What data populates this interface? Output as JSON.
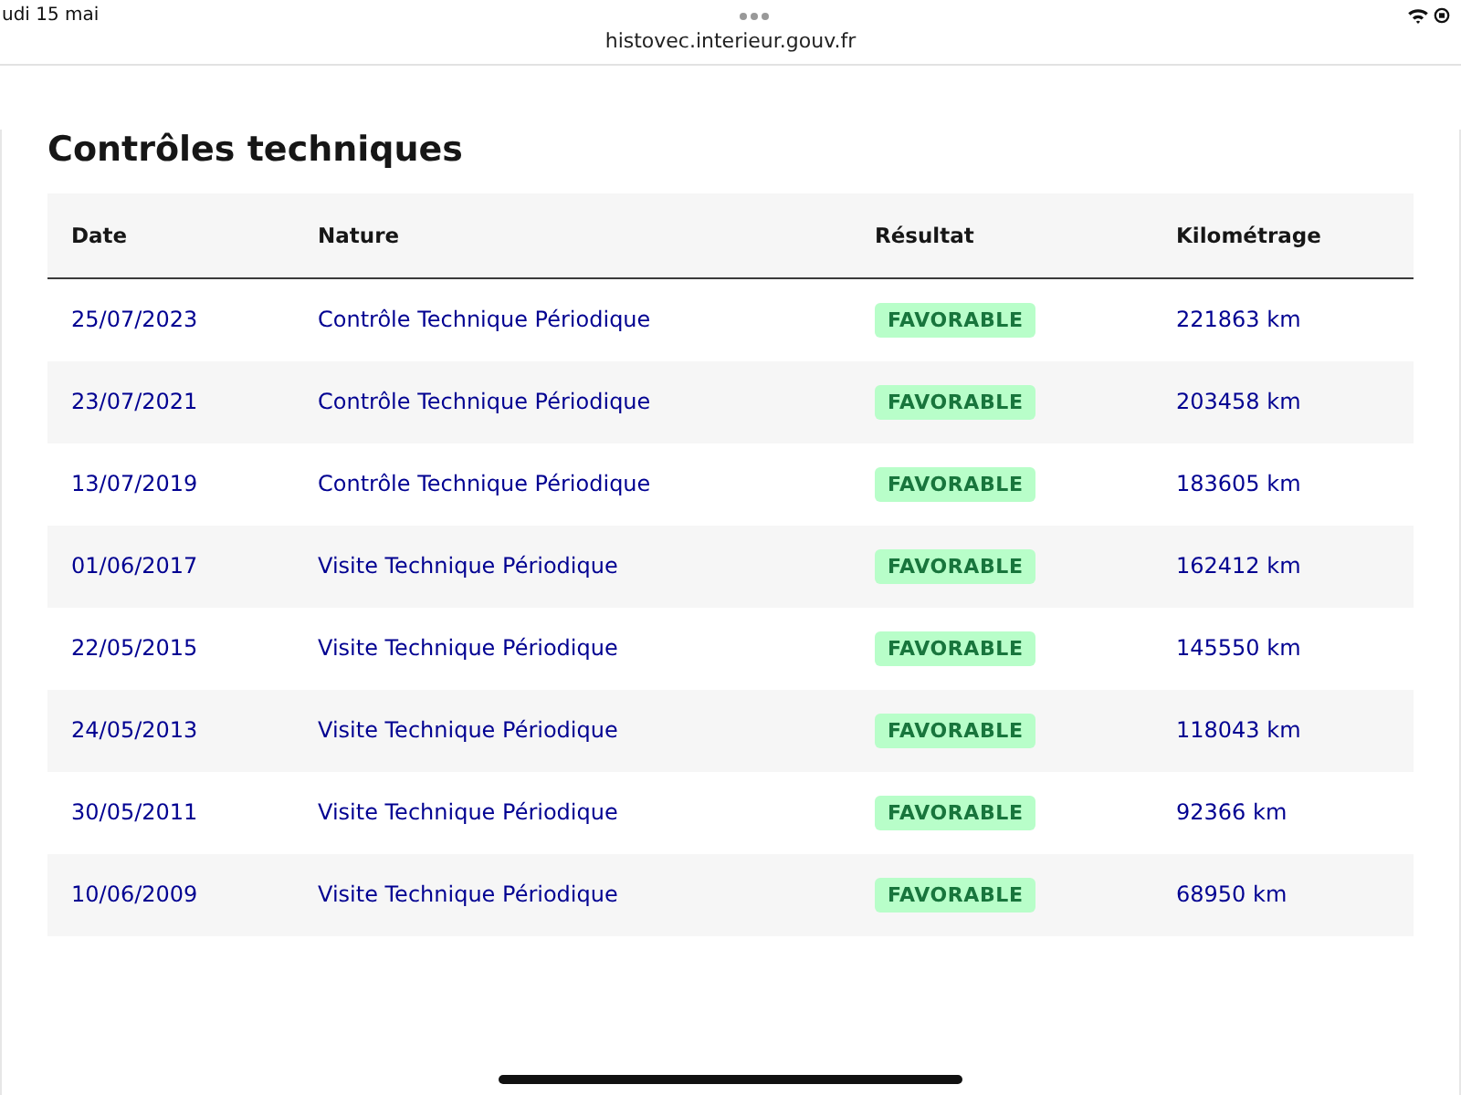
{
  "status_bar": {
    "date": "udi 15 mai"
  },
  "browser": {
    "url": "histovec.interieur.gouv.fr"
  },
  "section": {
    "title": "Contrôles techniques"
  },
  "table": {
    "columns": [
      "Date",
      "Nature",
      "Résultat",
      "Kilométrage"
    ],
    "rows": [
      {
        "date": "25/07/2023",
        "nature": "Contrôle Technique Périodique",
        "result": "FAVORABLE",
        "mileage": "221863 km"
      },
      {
        "date": "23/07/2021",
        "nature": "Contrôle Technique Périodique",
        "result": "FAVORABLE",
        "mileage": "203458 km"
      },
      {
        "date": "13/07/2019",
        "nature": "Contrôle Technique Périodique",
        "result": "FAVORABLE",
        "mileage": "183605 km"
      },
      {
        "date": "01/06/2017",
        "nature": "Visite Technique Périodique",
        "result": "FAVORABLE",
        "mileage": "162412 km"
      },
      {
        "date": "22/05/2015",
        "nature": "Visite Technique Périodique",
        "result": "FAVORABLE",
        "mileage": "145550 km"
      },
      {
        "date": "24/05/2013",
        "nature": "Visite Technique Périodique",
        "result": "FAVORABLE",
        "mileage": "118043 km"
      },
      {
        "date": "30/05/2011",
        "nature": "Visite Technique Périodique",
        "result": "FAVORABLE",
        "mileage": "92366 km"
      },
      {
        "date": "10/06/2009",
        "nature": "Visite Technique Périodique",
        "result": "FAVORABLE",
        "mileage": "68950 km"
      }
    ]
  }
}
